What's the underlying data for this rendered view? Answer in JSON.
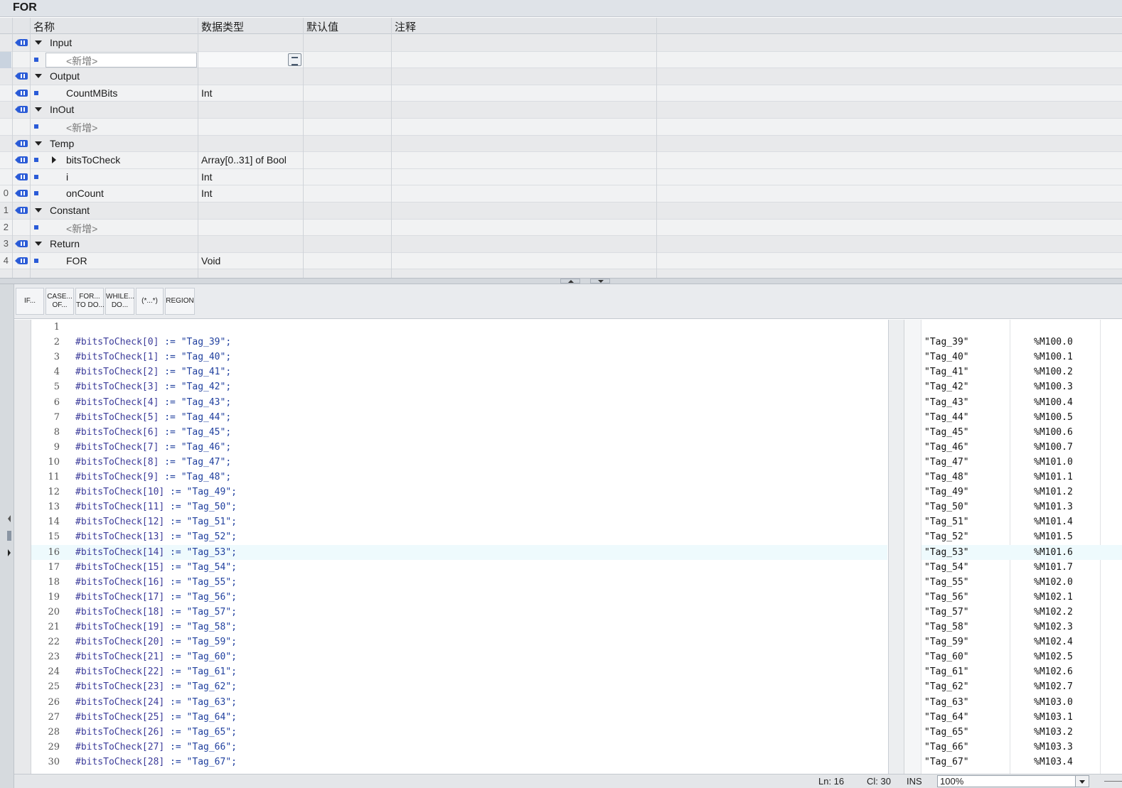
{
  "title": "FOR",
  "interface_table": {
    "headers": [
      "名称",
      "数据类型",
      "默认值",
      "注释"
    ],
    "rows": [
      {
        "num": "",
        "kind": "section",
        "name": "Input",
        "type": ""
      },
      {
        "num": "",
        "kind": "new",
        "name": "<新增>",
        "type": ""
      },
      {
        "num": "",
        "kind": "section",
        "name": "Output",
        "type": ""
      },
      {
        "num": "",
        "kind": "item",
        "name": "CountMBits",
        "type": "Int"
      },
      {
        "num": "",
        "kind": "section",
        "name": "InOut",
        "type": ""
      },
      {
        "num": "",
        "kind": "new",
        "name": "<新增>",
        "type": ""
      },
      {
        "num": "",
        "kind": "section",
        "name": "Temp",
        "type": ""
      },
      {
        "num": "",
        "kind": "item-expand",
        "name": "bitsToCheck",
        "type": "Array[0..31] of Bool"
      },
      {
        "num": "",
        "kind": "item",
        "name": "i",
        "type": "Int"
      },
      {
        "num": "0",
        "kind": "item",
        "name": "onCount",
        "type": "Int"
      },
      {
        "num": "1",
        "kind": "section",
        "name": "Constant",
        "type": ""
      },
      {
        "num": "2",
        "kind": "new",
        "name": "<新增>",
        "type": ""
      },
      {
        "num": "3",
        "kind": "section",
        "name": "Return",
        "type": ""
      },
      {
        "num": "4",
        "kind": "item",
        "name": "FOR",
        "type": "Void"
      }
    ]
  },
  "toolbar": [
    {
      "label": "IF...",
      "icon": "if-template-icon"
    },
    {
      "label": "CASE...\nOF...",
      "icon": "case-template-icon"
    },
    {
      "label": "FOR...\nTO DO...",
      "icon": "for-template-icon"
    },
    {
      "label": "WHILE...\nDO...",
      "icon": "while-template-icon"
    },
    {
      "label": "(*...*)",
      "icon": "comment-template-icon"
    },
    {
      "label": "REGION",
      "icon": "region-template-icon"
    }
  ],
  "editor": {
    "current_line": 16,
    "lines": [
      {
        "n": "1",
        "var": "",
        "rest": ""
      },
      {
        "n": "2",
        "var": "#bitsToCheck[0]",
        "rest": " := \"Tag_39\";"
      },
      {
        "n": "3",
        "var": "#bitsToCheck[1]",
        "rest": " := \"Tag_40\";"
      },
      {
        "n": "4",
        "var": "#bitsToCheck[2]",
        "rest": " := \"Tag_41\";"
      },
      {
        "n": "5",
        "var": "#bitsToCheck[3]",
        "rest": " := \"Tag_42\";"
      },
      {
        "n": "6",
        "var": "#bitsToCheck[4]",
        "rest": " := \"Tag_43\";"
      },
      {
        "n": "7",
        "var": "#bitsToCheck[5]",
        "rest": " := \"Tag_44\";"
      },
      {
        "n": "8",
        "var": "#bitsToCheck[6]",
        "rest": " := \"Tag_45\";"
      },
      {
        "n": "9",
        "var": "#bitsToCheck[7]",
        "rest": " := \"Tag_46\";"
      },
      {
        "n": "10",
        "var": "#bitsToCheck[8]",
        "rest": " := \"Tag_47\";"
      },
      {
        "n": "11",
        "var": "#bitsToCheck[9]",
        "rest": " := \"Tag_48\";"
      },
      {
        "n": "12",
        "var": "#bitsToCheck[10]",
        "rest": " := \"Tag_49\";"
      },
      {
        "n": "13",
        "var": "#bitsToCheck[11]",
        "rest": " := \"Tag_50\";"
      },
      {
        "n": "14",
        "var": "#bitsToCheck[12]",
        "rest": " := \"Tag_51\";"
      },
      {
        "n": "15",
        "var": "#bitsToCheck[13]",
        "rest": " := \"Tag_52\";"
      },
      {
        "n": "16",
        "var": "#bitsToCheck[14]",
        "rest": " := \"Tag_53\";"
      },
      {
        "n": "17",
        "var": "#bitsToCheck[15]",
        "rest": " := \"Tag_54\";"
      },
      {
        "n": "18",
        "var": "#bitsToCheck[16]",
        "rest": " := \"Tag_55\";"
      },
      {
        "n": "19",
        "var": "#bitsToCheck[17]",
        "rest": " := \"Tag_56\";"
      },
      {
        "n": "20",
        "var": "#bitsToCheck[18]",
        "rest": " := \"Tag_57\";"
      },
      {
        "n": "21",
        "var": "#bitsToCheck[19]",
        "rest": " := \"Tag_58\";"
      },
      {
        "n": "22",
        "var": "#bitsToCheck[20]",
        "rest": " := \"Tag_59\";"
      },
      {
        "n": "23",
        "var": "#bitsToCheck[21]",
        "rest": " := \"Tag_60\";"
      },
      {
        "n": "24",
        "var": "#bitsToCheck[22]",
        "rest": " := \"Tag_61\";"
      },
      {
        "n": "25",
        "var": "#bitsToCheck[23]",
        "rest": " := \"Tag_62\";"
      },
      {
        "n": "26",
        "var": "#bitsToCheck[24]",
        "rest": " := \"Tag_63\";"
      },
      {
        "n": "27",
        "var": "#bitsToCheck[25]",
        "rest": " := \"Tag_64\";"
      },
      {
        "n": "28",
        "var": "#bitsToCheck[26]",
        "rest": " := \"Tag_65\";"
      },
      {
        "n": "29",
        "var": "#bitsToCheck[27]",
        "rest": " := \"Tag_66\";"
      },
      {
        "n": "30",
        "var": "#bitsToCheck[28]",
        "rest": " := \"Tag_67\";"
      }
    ]
  },
  "tag_panel": [
    {
      "name": "",
      "addr": ""
    },
    {
      "name": "\"Tag_39\"",
      "addr": "%M100.0"
    },
    {
      "name": "\"Tag_40\"",
      "addr": "%M100.1"
    },
    {
      "name": "\"Tag_41\"",
      "addr": "%M100.2"
    },
    {
      "name": "\"Tag_42\"",
      "addr": "%M100.3"
    },
    {
      "name": "\"Tag_43\"",
      "addr": "%M100.4"
    },
    {
      "name": "\"Tag_44\"",
      "addr": "%M100.5"
    },
    {
      "name": "\"Tag_45\"",
      "addr": "%M100.6"
    },
    {
      "name": "\"Tag_46\"",
      "addr": "%M100.7"
    },
    {
      "name": "\"Tag_47\"",
      "addr": "%M101.0"
    },
    {
      "name": "\"Tag_48\"",
      "addr": "%M101.1"
    },
    {
      "name": "\"Tag_49\"",
      "addr": "%M101.2"
    },
    {
      "name": "\"Tag_50\"",
      "addr": "%M101.3"
    },
    {
      "name": "\"Tag_51\"",
      "addr": "%M101.4"
    },
    {
      "name": "\"Tag_52\"",
      "addr": "%M101.5"
    },
    {
      "name": "\"Tag_53\"",
      "addr": "%M101.6"
    },
    {
      "name": "\"Tag_54\"",
      "addr": "%M101.7"
    },
    {
      "name": "\"Tag_55\"",
      "addr": "%M102.0"
    },
    {
      "name": "\"Tag_56\"",
      "addr": "%M102.1"
    },
    {
      "name": "\"Tag_57\"",
      "addr": "%M102.2"
    },
    {
      "name": "\"Tag_58\"",
      "addr": "%M102.3"
    },
    {
      "name": "\"Tag_59\"",
      "addr": "%M102.4"
    },
    {
      "name": "\"Tag_60\"",
      "addr": "%M102.5"
    },
    {
      "name": "\"Tag_61\"",
      "addr": "%M102.6"
    },
    {
      "name": "\"Tag_62\"",
      "addr": "%M102.7"
    },
    {
      "name": "\"Tag_63\"",
      "addr": "%M103.0"
    },
    {
      "name": "\"Tag_64\"",
      "addr": "%M103.1"
    },
    {
      "name": "\"Tag_65\"",
      "addr": "%M103.2"
    },
    {
      "name": "\"Tag_66\"",
      "addr": "%M103.3"
    },
    {
      "name": "\"Tag_67\"",
      "addr": "%M103.4"
    }
  ],
  "status_bar": {
    "ln": "Ln: 16",
    "cl": "Cl: 30",
    "mode": "INS",
    "zoom": "100%"
  },
  "colors": {
    "interface_icon": "#2a5bd7",
    "current_line_bg": "#eefafd",
    "variable_text": "#3b3b9a"
  }
}
